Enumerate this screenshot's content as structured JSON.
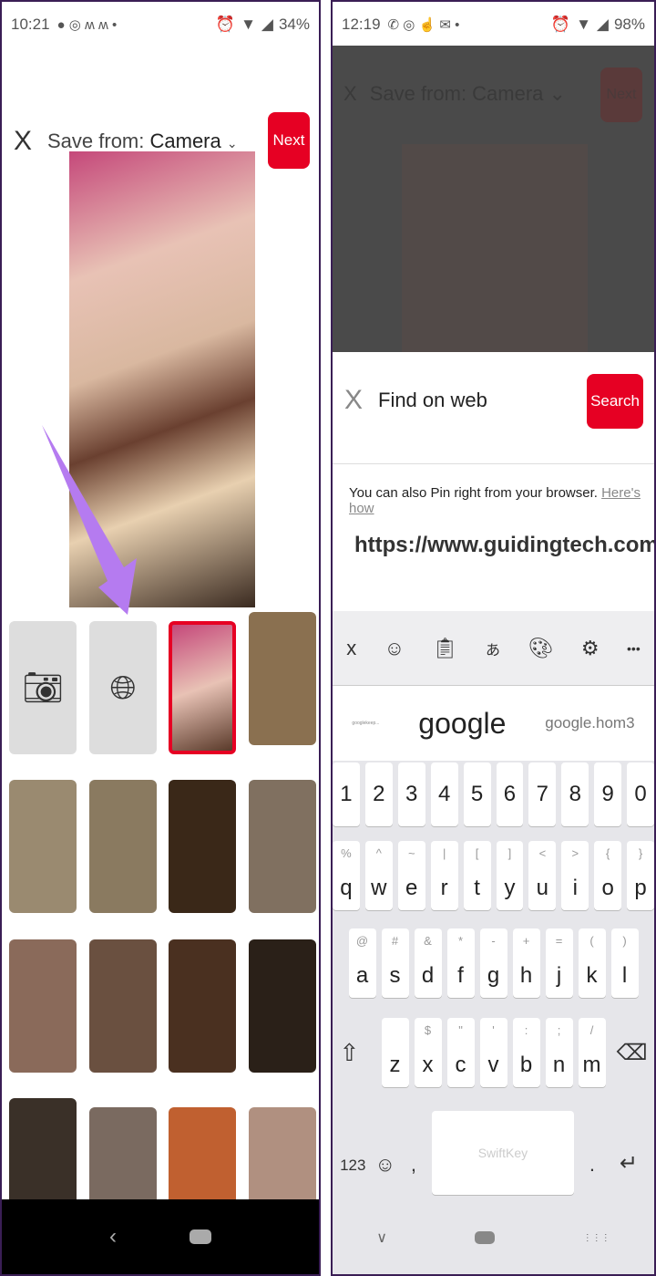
{
  "left": {
    "status": {
      "time": "10:21",
      "battery": "34%"
    },
    "header": {
      "close": "X",
      "title_prefix": "Save from:",
      "source": "Camera",
      "chevron": "⌄",
      "next": "Next"
    },
    "tiles": {
      "camera_icon": "camera-icon",
      "web_icon": "globe-icon"
    },
    "annotation": {
      "arrow_color": "#b57bf0"
    },
    "nav": {
      "back": "‹"
    }
  },
  "right": {
    "status": {
      "time": "12:19",
      "battery": "98%"
    },
    "bg_header": {
      "close": "X",
      "title": "Save from: Camera ⌄",
      "next": "Next"
    },
    "sheet": {
      "close": "X",
      "title": "Find on web",
      "search": "Search",
      "hint": "You can also Pin right from your browser.",
      "hint_link": "Here's how",
      "url": "https://www.guidingtech.com/google-"
    },
    "toolbar": {
      "close": "x",
      "more": "•••"
    },
    "suggestions": [
      "googlekeep...",
      "google",
      "google.hom3"
    ],
    "keyboard": {
      "numbers": [
        "1",
        "2",
        "3",
        "4",
        "5",
        "6",
        "7",
        "8",
        "9",
        "0"
      ],
      "row1": [
        [
          "q",
          "%"
        ],
        [
          "w",
          "^"
        ],
        [
          "e",
          "~"
        ],
        [
          "r",
          "|"
        ],
        [
          "t",
          "["
        ],
        [
          "y",
          "]"
        ],
        [
          "u",
          "<"
        ],
        [
          "i",
          ">"
        ],
        [
          "o",
          "{"
        ],
        [
          "p",
          "}"
        ]
      ],
      "row2": [
        [
          "a",
          "@"
        ],
        [
          "s",
          "#"
        ],
        [
          "d",
          "&"
        ],
        [
          "f",
          "*"
        ],
        [
          "g",
          "-"
        ],
        [
          "h",
          "+"
        ],
        [
          "j",
          "="
        ],
        [
          "k",
          "("
        ],
        [
          "l",
          ")"
        ]
      ],
      "row3": [
        [
          "z",
          ""
        ],
        [
          "x",
          "$"
        ],
        [
          "c",
          "\""
        ],
        [
          "v",
          "'"
        ],
        [
          "b",
          ":"
        ],
        [
          "n",
          ";"
        ],
        [
          "m",
          "/"
        ]
      ],
      "shift": "⇧",
      "backspace": "⌫",
      "sym": "123",
      "emoji": "☺",
      "comma": ",",
      "space": "SwiftKey",
      "period": ".",
      "enter": "↵"
    },
    "nav": {
      "back": "∨",
      "apps": "⋮⋮⋮"
    }
  },
  "colors": {
    "accent": "#e60023"
  }
}
